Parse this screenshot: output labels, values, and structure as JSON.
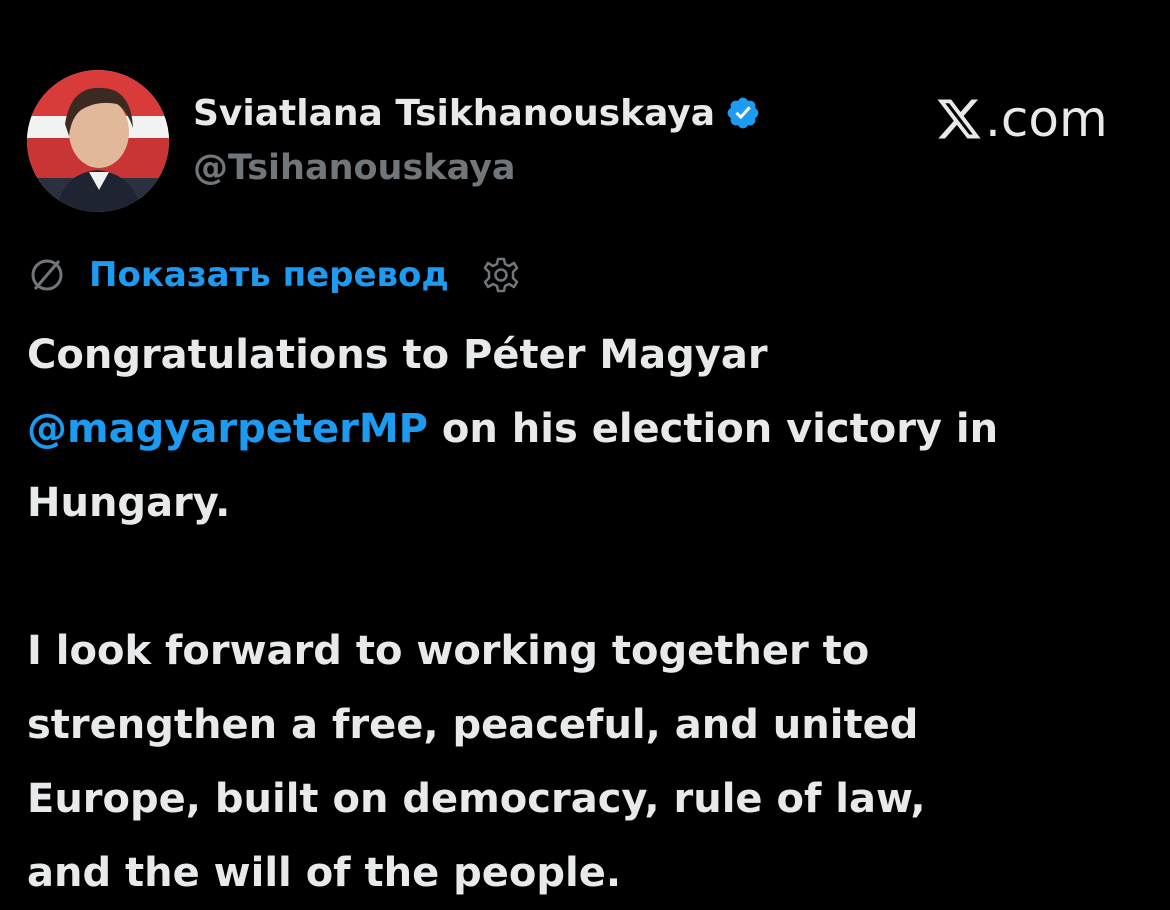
{
  "tweet": {
    "author": {
      "display_name": "Sviatlana Tsikhanouskaya",
      "handle": "@Tsihanouskaya",
      "verified": true
    },
    "site_label": ".com",
    "translate_label": "Показать перевод",
    "paragraphs": {
      "first": {
        "line1": "Congratulations to Péter Magyar",
        "mention": "@magyarpeterMP",
        "line2_rest": " on his election victory in",
        "line3": "Hungary."
      },
      "second": {
        "line1": "I look forward to working together to",
        "line2": "strengthen a free, peaceful, and united",
        "line3": "Europe, built on democracy, rule of law,",
        "line4": "and the will of the people."
      }
    }
  },
  "colors": {
    "background": "#000000",
    "text": "#e7e9ea",
    "secondary_text": "#71767b",
    "accent": "#1d9bf0"
  },
  "icons": {
    "verified": "verified-badge-icon",
    "brand": "x-logo-icon",
    "translate": "globe-icon",
    "settings": "gear-icon"
  }
}
